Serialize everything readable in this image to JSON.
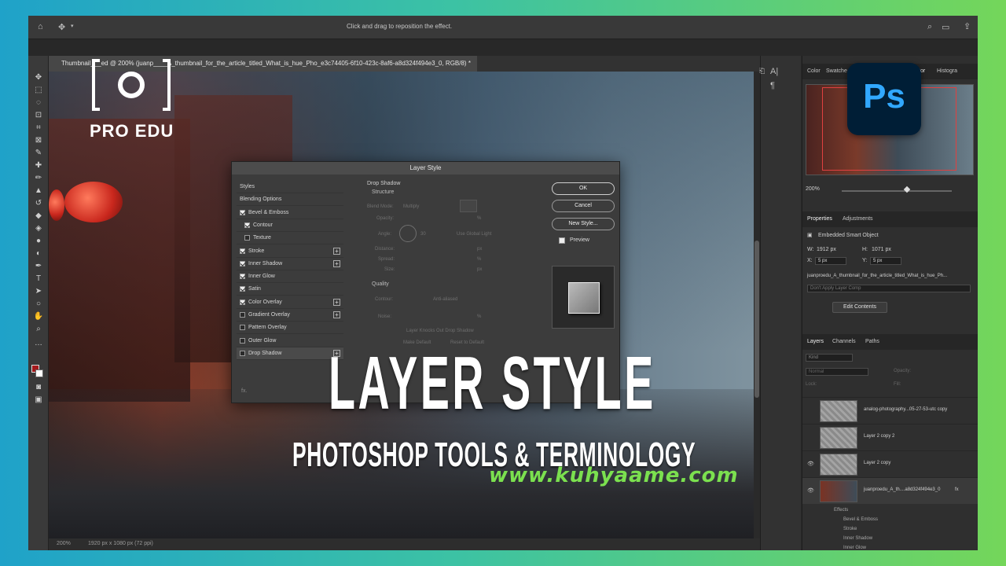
{
  "options_bar": {
    "hint": "Click and drag to reposition the effect."
  },
  "document_tab": {
    "label": "Thumbnail___ed @ 200% (juanp____A_thumbnail_for_the_article_titled_What_is_hue_Pho_e3c74405-6f10-423c-8af6-a8d324f494e3_0, RGB/8) *"
  },
  "status": {
    "zoom": "200%",
    "dims": "1920 px x 1080 px (72 ppi)"
  },
  "colors": {
    "foreground": "#a3191c",
    "background": "#ffffff",
    "accent": "#31a8ff"
  },
  "nav_panel": {
    "tabs": [
      "Color",
      "Swatche",
      "tor",
      "Histogra"
    ],
    "zoom": "200%"
  },
  "properties": {
    "tabs": [
      "Properties",
      "Adjustments"
    ],
    "type": "Embedded Smart Object",
    "w": "1912 px",
    "h": "1071 px",
    "x": "5 px",
    "y": "5 px",
    "w_label": "W:",
    "h_label": "H:",
    "x_label": "X:",
    "y_label": "Y:",
    "filename": "juanproedu_A_thumbnail_for_the_article_titled_What_is_hue_Ph...",
    "layer_comp": "Don't Apply Layer Comp",
    "edit_button": "Edit Contents"
  },
  "layers_panel": {
    "tabs": [
      "Layers",
      "Channels",
      "Paths"
    ],
    "filter": "Kind",
    "blend": "Normal",
    "opacity_label": "Opacity:",
    "lock_label": "Lock:",
    "fill_label": "Fill:",
    "layers": [
      {
        "name": "analog-photography...05-27-53-utc copy"
      },
      {
        "name": "Layer 2 copy 2"
      },
      {
        "name": "Layer 2 copy"
      },
      {
        "name": "juanproedu_A_th....a8d324f494e3_0"
      }
    ],
    "effects_label": "Effects",
    "effects": [
      "Bevel & Emboss",
      "Stroke",
      "Inner Shadow",
      "Inner Glow"
    ],
    "fx": "fx"
  },
  "dialog": {
    "title": "Layer Style",
    "list": [
      {
        "label": "Styles",
        "cb": null,
        "plus": false
      },
      {
        "label": "Blending Options",
        "cb": null,
        "plus": false
      },
      {
        "label": "Bevel & Emboss",
        "cb": true,
        "plus": false
      },
      {
        "label": "Contour",
        "cb": true,
        "plus": false,
        "indent": true
      },
      {
        "label": "Texture",
        "cb": false,
        "plus": false,
        "indent": true
      },
      {
        "label": "Stroke",
        "cb": true,
        "plus": true
      },
      {
        "label": "Inner Shadow",
        "cb": true,
        "plus": true
      },
      {
        "label": "Inner Glow",
        "cb": true,
        "plus": false
      },
      {
        "label": "Satin",
        "cb": true,
        "plus": false
      },
      {
        "label": "Color Overlay",
        "cb": true,
        "plus": true
      },
      {
        "label": "Gradient Overlay",
        "cb": false,
        "plus": true
      },
      {
        "label": "Pattern Overlay",
        "cb": false,
        "plus": false
      },
      {
        "label": "Outer Glow",
        "cb": false,
        "plus": false
      },
      {
        "label": "Drop Shadow",
        "cb": false,
        "plus": true
      }
    ],
    "fx": "fx.",
    "section": "Drop Shadow",
    "structure": "Structure",
    "blend_mode_label": "Blend Mode:",
    "blend_mode": "Multiply",
    "opacity_label": "Opacity:",
    "angle_label": "Angle:",
    "angle_value": "30",
    "use_global_light": "Use Global Light",
    "distance_label": "Distance:",
    "spread_label": "Spread:",
    "size_label": "Size:",
    "px": "px",
    "pct": "%",
    "quality": "Quality",
    "contour_label": "Contour:",
    "anti_aliased": "Anti-aliased",
    "noise_label": "Noise:",
    "knocks_out": "Layer Knocks Out Drop Shadow",
    "make_default": "Make Default",
    "reset_default": "Reset to Default",
    "ok": "OK",
    "cancel": "Cancel",
    "new_style": "New Style...",
    "preview": "Preview"
  },
  "overlay": {
    "logo_text": "PRO EDU",
    "ps_badge": "Ps",
    "title": "LAYER STYLE",
    "subtitle": "PHOTOSHOP TOOLS & TERMINOLOGY",
    "watermark": "www.kuhyaame.com"
  }
}
